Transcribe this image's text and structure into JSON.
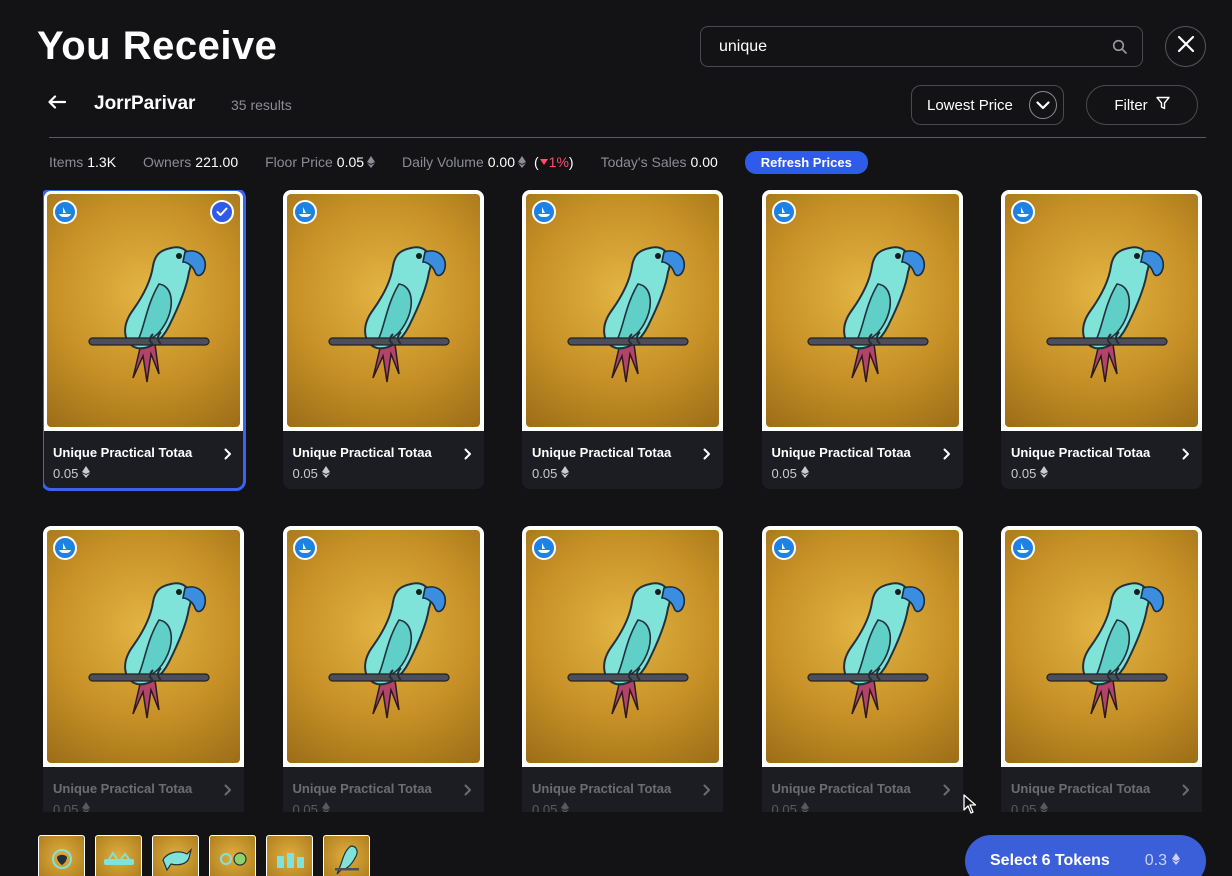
{
  "header": {
    "title": "You Receive",
    "search_value": "unique",
    "search_placeholder": "Search"
  },
  "collection": {
    "name": "JorrParivar",
    "results": "35 results"
  },
  "controls": {
    "sort_label": "Lowest Price",
    "filter_label": "Filter"
  },
  "stats": {
    "items_label": "Items",
    "items_value": "1.3K",
    "owners_label": "Owners",
    "owners_value": "221.00",
    "floor_label": "Floor Price",
    "floor_value": "0.05",
    "volume_label": "Daily Volume",
    "volume_value": "0.00",
    "volume_change": "1%",
    "sales_label": "Today's Sales",
    "sales_value": "0.00",
    "refresh_label": "Refresh Prices"
  },
  "cards": [
    {
      "name": "Unique Practical Totaa",
      "price": "0.05",
      "selected": true
    },
    {
      "name": "Unique Practical Totaa",
      "price": "0.05",
      "selected": false
    },
    {
      "name": "Unique Practical Totaa",
      "price": "0.05",
      "selected": false
    },
    {
      "name": "Unique Practical Totaa",
      "price": "0.05",
      "selected": false
    },
    {
      "name": "Unique Practical Totaa",
      "price": "0.05",
      "selected": false
    },
    {
      "name": "Unique Practical Totaa",
      "price": "0.05",
      "selected": false
    },
    {
      "name": "Unique Practical Totaa",
      "price": "0.05",
      "selected": false
    },
    {
      "name": "Unique Practical Totaa",
      "price": "0.05",
      "selected": false
    },
    {
      "name": "Unique Practical Totaa",
      "price": "0.05",
      "selected": false
    },
    {
      "name": "Unique Practical Totaa",
      "price": "0.05",
      "selected": false
    }
  ],
  "footer": {
    "select_label": "Select 6 Tokens",
    "select_amount": "0.3"
  },
  "colors": {
    "accent": "#2f5bea",
    "background": "#131316",
    "card_bg": "#1c1d22",
    "negative": "#ff4d6d"
  }
}
